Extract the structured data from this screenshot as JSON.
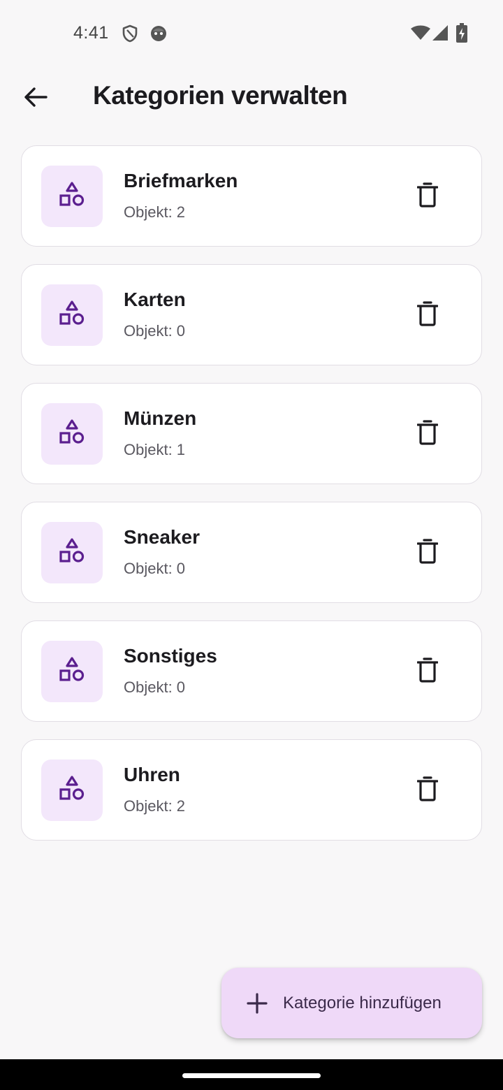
{
  "status_bar": {
    "time": "4:41",
    "left_icons": [
      "shield-icon",
      "face-icon"
    ],
    "right_icons": [
      "wifi-icon",
      "cell-signal-icon",
      "battery-charging-icon"
    ]
  },
  "app_bar": {
    "back_icon": "arrow-back-icon",
    "title": "Kategorien verwalten"
  },
  "categories": [
    {
      "name": "Briefmarken",
      "count_label": "Objekt: 2"
    },
    {
      "name": "Karten",
      "count_label": "Objekt: 0"
    },
    {
      "name": "Münzen",
      "count_label": "Objekt: 1"
    },
    {
      "name": "Sneaker",
      "count_label": "Objekt: 0"
    },
    {
      "name": "Sonstiges",
      "count_label": "Objekt: 0"
    },
    {
      "name": "Uhren",
      "count_label": "Objekt: 2"
    }
  ],
  "category_icon": "shapes-icon",
  "delete_icon": "delete-icon",
  "fab": {
    "icon": "plus-icon",
    "label": "Kategorie hinzufügen"
  },
  "colors": {
    "background": "#f8f7f8",
    "card": "#ffffff",
    "icon_tile": "#f3e7fb",
    "icon_accent": "#5b1f8f",
    "fab": "#efd9f8"
  }
}
